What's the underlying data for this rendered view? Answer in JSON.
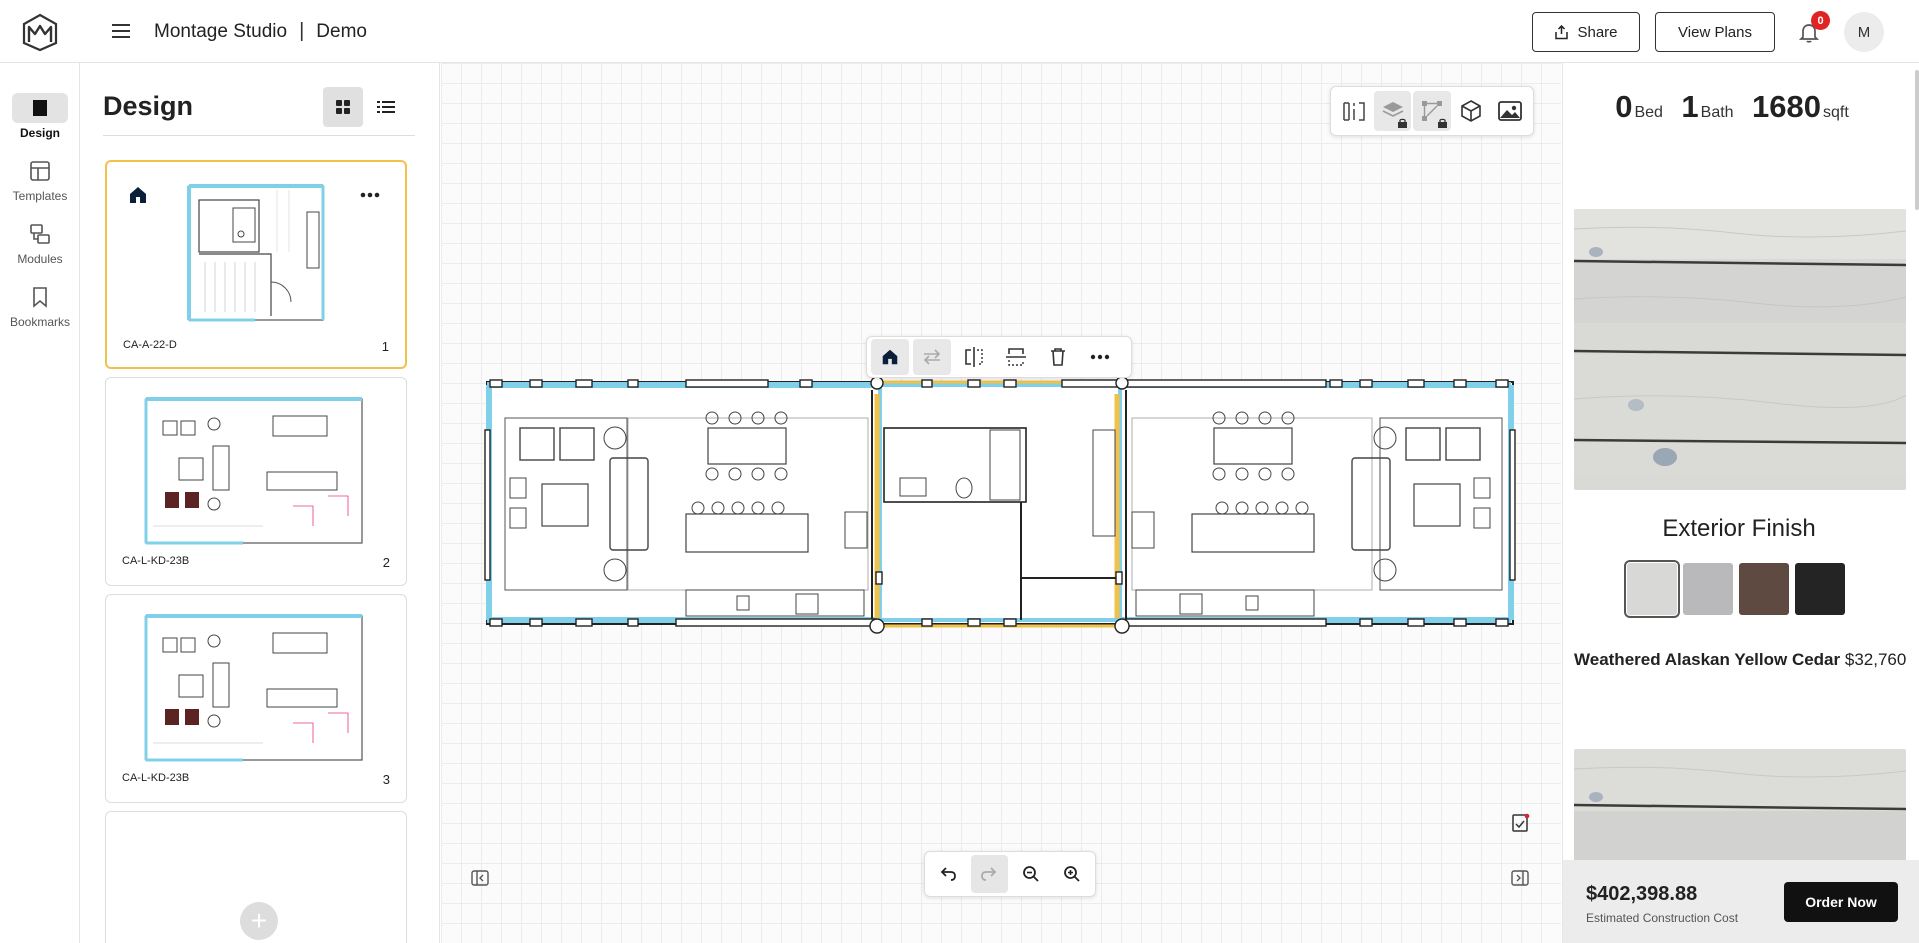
{
  "app": {
    "name": "Montage Studio",
    "project": "Demo",
    "separator": "|"
  },
  "header": {
    "share_label": "Share",
    "view_plans_label": "View Plans",
    "notification_count": "0",
    "avatar_initial": "M"
  },
  "rail": {
    "items": [
      {
        "label": "Design",
        "icon": "square-icon",
        "active": true
      },
      {
        "label": "Templates",
        "icon": "template-icon",
        "active": false
      },
      {
        "label": "Modules",
        "icon": "modules-icon",
        "active": false
      },
      {
        "label": "Bookmarks",
        "icon": "bookmark-icon",
        "active": false
      }
    ]
  },
  "panel": {
    "title": "Design",
    "cards": [
      {
        "code": "CA-A-22-D",
        "num": "1",
        "active": true
      },
      {
        "code": "CA-L-KD-23B",
        "num": "2",
        "active": false
      },
      {
        "code": "CA-L-KD-23B",
        "num": "3",
        "active": false
      }
    ],
    "add_symbol": "+"
  },
  "specs": {
    "beds": "0",
    "beds_unit": "Bed",
    "baths": "1",
    "baths_unit": "Bath",
    "sqft": "1680",
    "sqft_unit": "sqft"
  },
  "exterior": {
    "title": "Exterior Finish",
    "selected_name": "Weathered Alaskan Yellow Cedar",
    "selected_price": "$32,760",
    "swatch_colors": [
      "#d8d8d8",
      "#b9b9bb",
      "#5e4a40",
      "#242424"
    ]
  },
  "cost": {
    "value": "$402,398.88",
    "label": "Estimated Construction Cost",
    "order_label": "Order Now"
  },
  "colors": {
    "accent_selected": "#f0c14b",
    "module_wall": "#7fd0e8",
    "badge": "#e02424"
  }
}
